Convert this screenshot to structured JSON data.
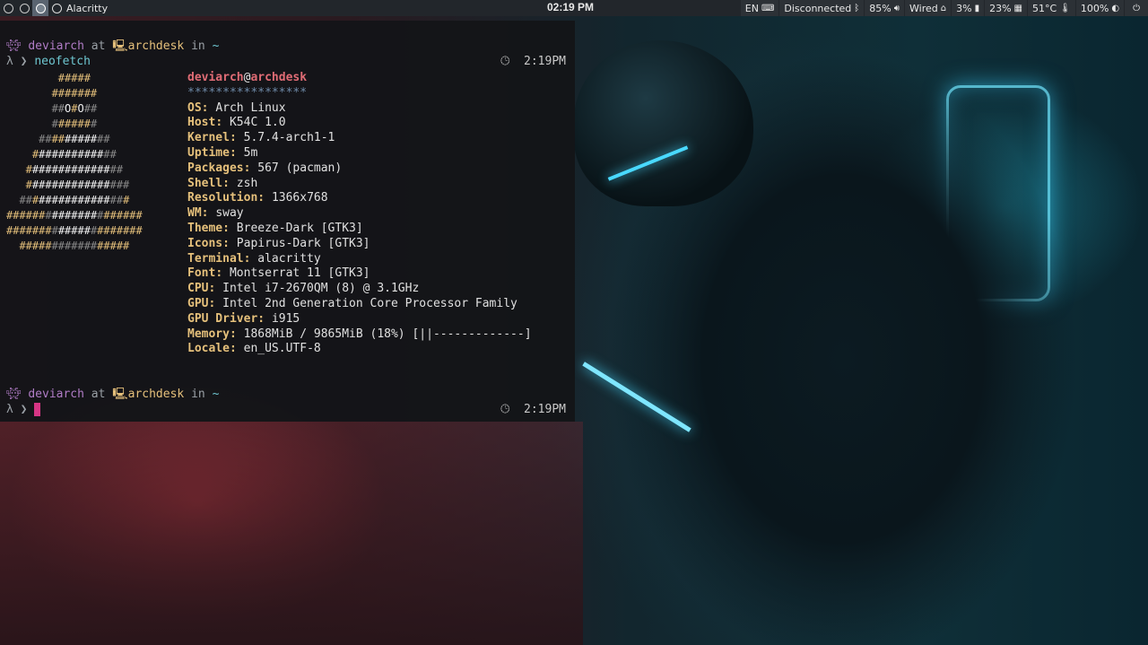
{
  "topbar": {
    "workspaces": [
      "",
      "",
      ""
    ],
    "app_title": "Alacritty",
    "clock": "02:19 PM",
    "tray": {
      "lang": "EN",
      "bluetooth": "Disconnected",
      "volume": "85%",
      "network": "Wired",
      "cpu": "3%",
      "memory": "23%",
      "temp": "51°C",
      "brightness": "100%"
    }
  },
  "terminal": {
    "prompt1": {
      "user": "deviarch",
      "at": "at",
      "host": "archdesk",
      "in": "in",
      "dir": "~"
    },
    "cmd_line": {
      "lambda": "λ ❯",
      "command": "neofetch",
      "time": "2:19PM"
    },
    "prompt2": {
      "user": "deviarch",
      "at": "at",
      "host": "archdesk",
      "in": "in",
      "dir": "~"
    },
    "cursor_line": {
      "lambda": "λ ❯",
      "time": "2:19PM"
    },
    "neofetch": {
      "user": "deviarch",
      "at": "@",
      "host": "archdesk",
      "underline": "*****************",
      "fields": [
        {
          "key": "OS",
          "value": "Arch Linux"
        },
        {
          "key": "Host",
          "value": "K54C 1.0"
        },
        {
          "key": "Kernel",
          "value": "5.7.4-arch1-1"
        },
        {
          "key": "Uptime",
          "value": "5m"
        },
        {
          "key": "Packages",
          "value": "567 (pacman)"
        },
        {
          "key": "Shell",
          "value": "zsh"
        },
        {
          "key": "Resolution",
          "value": "1366x768"
        },
        {
          "key": "WM",
          "value": "sway"
        },
        {
          "key": "Theme",
          "value": "Breeze-Dark [GTK3]"
        },
        {
          "key": "Icons",
          "value": "Papirus-Dark [GTK3]"
        },
        {
          "key": "Terminal",
          "value": "alacritty"
        },
        {
          "key": "Font",
          "value": "Montserrat 11 [GTK3]"
        },
        {
          "key": "CPU",
          "value": "Intel i7-2670QM (8) @ 3.1GHz"
        },
        {
          "key": "GPU",
          "value": "Intel 2nd Generation Core Processor Family"
        },
        {
          "key": "GPU Driver",
          "value": "i915"
        },
        {
          "key": "Memory",
          "value": "1868MiB / 9865MiB (18%) [||-------------]"
        },
        {
          "key": "Locale",
          "value": "en_US.UTF-8"
        }
      ]
    }
  },
  "colors": {
    "cursor": "#d63584",
    "accent_yellow": "#e5c07b",
    "accent_red": "#e06c75",
    "prompt_purple": "#b07cc6"
  }
}
